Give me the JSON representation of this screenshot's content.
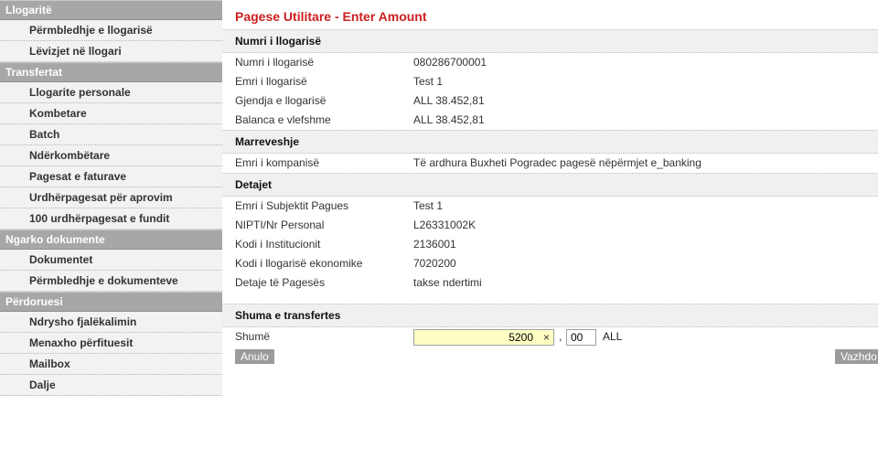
{
  "sidebar": {
    "sections": [
      {
        "title": "Llogaritë",
        "items": [
          "Përmbledhje e llogarisë",
          "Lëvizjet në llogari"
        ]
      },
      {
        "title": "Transfertat",
        "items": [
          "Llogarite personale",
          "Kombetare",
          "Batch",
          "Ndërkombëtare",
          "Pagesat e faturave",
          "Urdhërpagesat për aprovim",
          "100 urdhërpagesat e fundit"
        ]
      },
      {
        "title": "Ngarko dokumente",
        "items": [
          "Dokumentet",
          "Përmbledhje e dokumenteve"
        ]
      },
      {
        "title": "Përdoruesi",
        "items": [
          "Ndrysho fjalëkalimin",
          "Menaxho përfituesit",
          "Mailbox",
          "Dalje"
        ]
      }
    ]
  },
  "page": {
    "title": "Pagese Utilitare - Enter Amount"
  },
  "account_section": {
    "title": "Numri i llogarisë",
    "rows": [
      {
        "label": "Numri i llogarisë",
        "value": "080286700001"
      },
      {
        "label": "Emri i llogarisë",
        "value": "Test 1"
      },
      {
        "label": "Gjendja e llogarisë",
        "value": "ALL 38.452,81"
      },
      {
        "label": "Balanca e vlefshme",
        "value": "ALL 38.452,81"
      }
    ]
  },
  "agreement_section": {
    "title": "Marreveshje",
    "rows": [
      {
        "label": "Emri i kompanisë",
        "value": "Të ardhura Buxheti Pogradec pagesë nëpërmjet e_banking"
      }
    ]
  },
  "details_section": {
    "title": "Detajet",
    "rows": [
      {
        "label": "Emri i Subjektit Pagues",
        "value": "Test 1"
      },
      {
        "label": "NIPTI/Nr Personal",
        "value": "L26331002K"
      },
      {
        "label": "Kodi i Institucionit",
        "value": "2136001"
      },
      {
        "label": "Kodi i llogarisë ekonomike",
        "value": "7020200"
      },
      {
        "label": "Detaje të Pagesës",
        "value": "takse ndertimi"
      }
    ]
  },
  "amount_section": {
    "title": "Shuma e transfertes",
    "label": "Shumë",
    "amount_value": "5200",
    "clear_glyph": "×",
    "separator": ",",
    "cents_value": "00",
    "currency": "ALL"
  },
  "buttons": {
    "cancel": "Anulo",
    "continue": "Vazhdo >"
  }
}
